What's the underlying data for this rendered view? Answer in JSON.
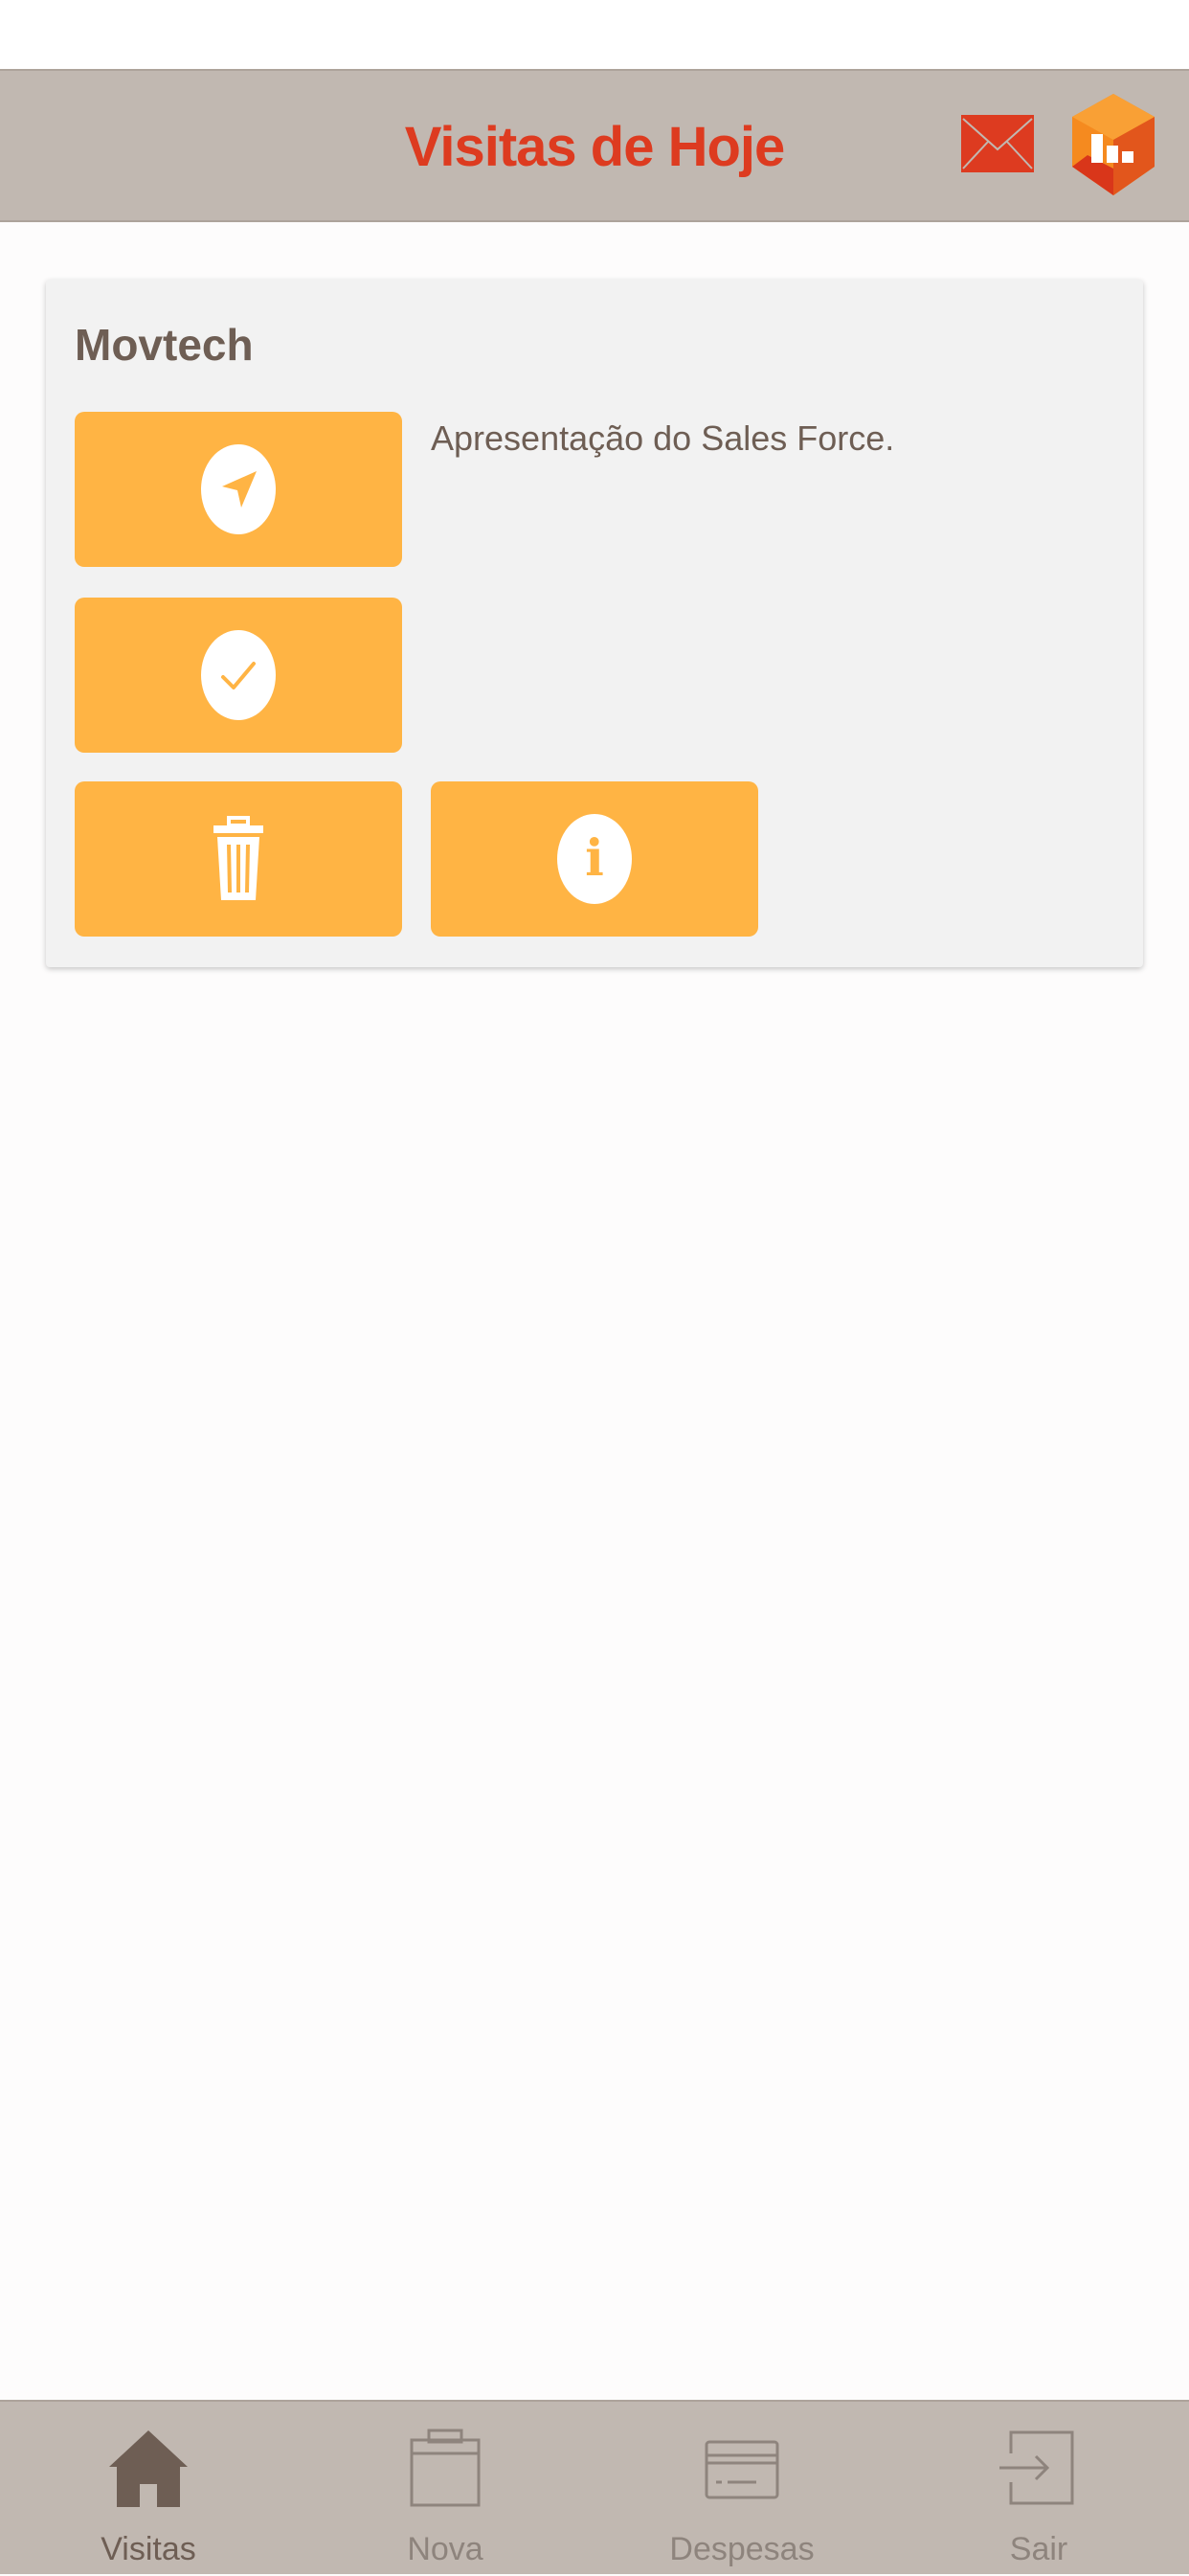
{
  "header": {
    "title": "Visitas de Hoje",
    "mail_icon": "mail-icon",
    "logo_icon": "app-logo"
  },
  "visit": {
    "company": "Movtech",
    "description": "Apresentação do Sales Force.",
    "actions": [
      {
        "icon": "navigation-arrow-icon"
      },
      {
        "icon": "checkmark-icon"
      },
      {
        "icon": "trash-icon"
      },
      {
        "icon": "info-icon",
        "glyph": "i"
      }
    ]
  },
  "tabbar": {
    "items": [
      {
        "label": "Visitas",
        "icon": "home-icon",
        "active": true
      },
      {
        "label": "Nova",
        "icon": "calendar-icon",
        "active": false
      },
      {
        "label": "Despesas",
        "icon": "credit-card-icon",
        "active": false
      },
      {
        "label": "Sair",
        "icon": "exit-icon",
        "active": false
      }
    ]
  },
  "colors": {
    "accent": "#FFB444",
    "title_red": "#DD3B20",
    "bar_bg": "#C1B8B1",
    "text_brown": "#6E5E54",
    "inactive_tab": "#8E847D"
  }
}
